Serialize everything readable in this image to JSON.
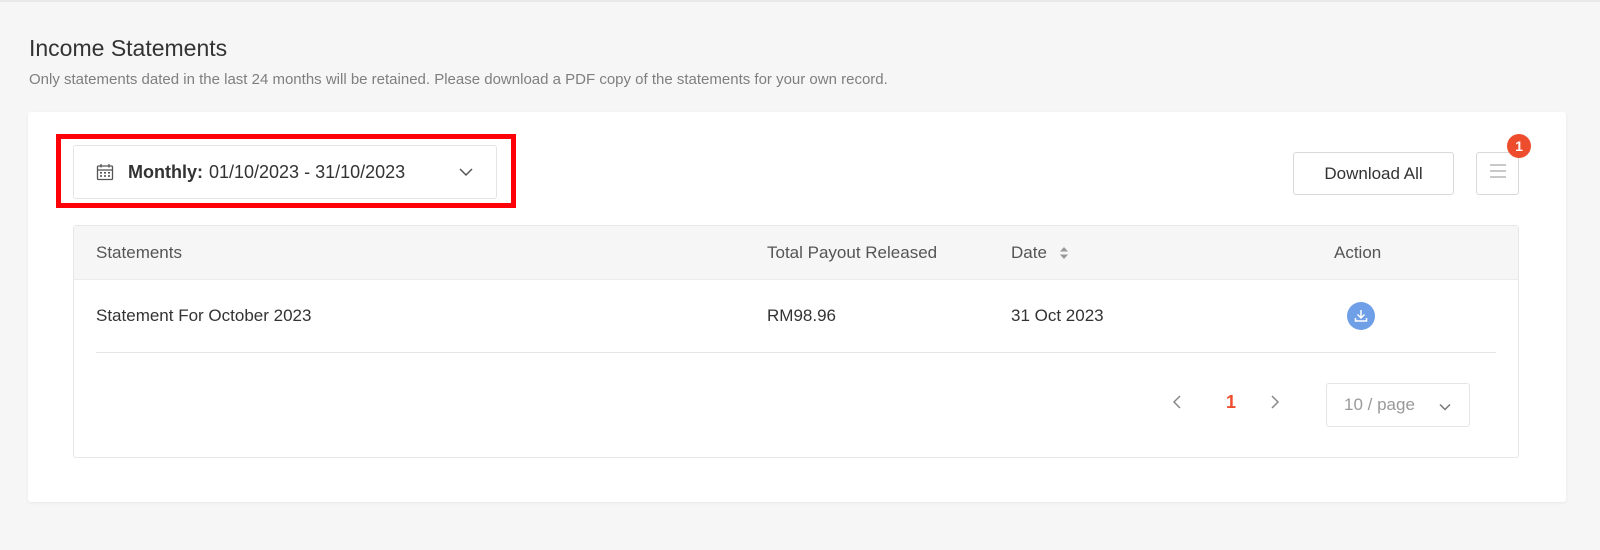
{
  "header": {
    "title": "Income Statements",
    "subtitle": "Only statements dated in the last 24 months will be retained. Please download a PDF copy of the statements for your own record."
  },
  "filter": {
    "label": "Monthly:",
    "value": "01/10/2023 - 31/10/2023"
  },
  "toolbar": {
    "download_all_label": "Download All",
    "badge_count": "1"
  },
  "table": {
    "columns": [
      "Statements",
      "Total Payout Released",
      "Date",
      "Action"
    ],
    "rows": [
      {
        "statement": "Statement For October 2023",
        "payout": "RM98.96",
        "date": "31 Oct 2023"
      }
    ]
  },
  "pagination": {
    "current_page": "1",
    "page_size": "10 / page"
  },
  "colors": {
    "accent": "#ee4d2d",
    "highlight_border": "#ff0008",
    "download_icon": "#6f9fe6"
  }
}
